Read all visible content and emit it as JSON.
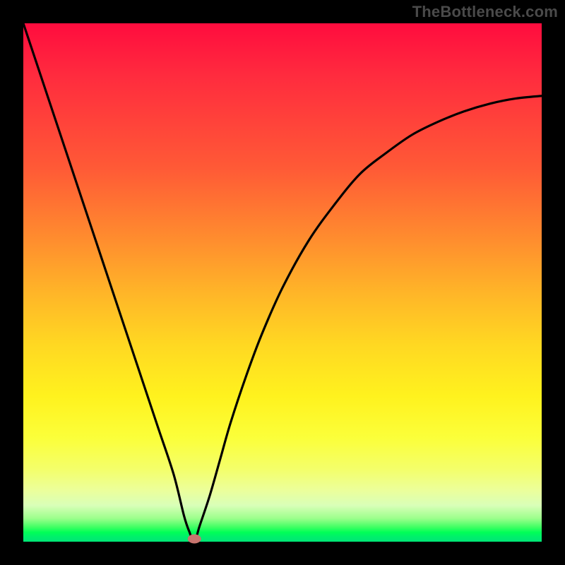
{
  "watermark": "TheBottleneck.com",
  "colors": {
    "frame": "#000000",
    "curve": "#000000",
    "marker": "#c9756f",
    "gradient_top": "#ff0c3e",
    "gradient_bottom": "#00e676"
  },
  "chart_data": {
    "type": "line",
    "title": "",
    "xlabel": "",
    "ylabel": "",
    "xlim": [
      0,
      100
    ],
    "ylim": [
      0,
      100
    ],
    "grid": false,
    "legend": false,
    "annotations": [
      "TheBottleneck.com"
    ],
    "series": [
      {
        "name": "bottleneck-curve",
        "x": [
          0,
          2,
          5,
          8,
          11,
          14,
          17,
          20,
          23,
          26,
          29,
          31,
          32,
          33,
          34,
          36,
          38,
          40,
          43,
          46,
          50,
          55,
          60,
          65,
          70,
          75,
          80,
          85,
          90,
          95,
          100
        ],
        "y": [
          100,
          94,
          85,
          76,
          67,
          58,
          49,
          40,
          31,
          22,
          13,
          5,
          2,
          0,
          3,
          9,
          16,
          23,
          32,
          40,
          49,
          58,
          65,
          71,
          75,
          78.5,
          81,
          83,
          84.5,
          85.5,
          86
        ]
      }
    ],
    "marker": {
      "x": 33,
      "y": 0,
      "shape": "oval"
    }
  }
}
